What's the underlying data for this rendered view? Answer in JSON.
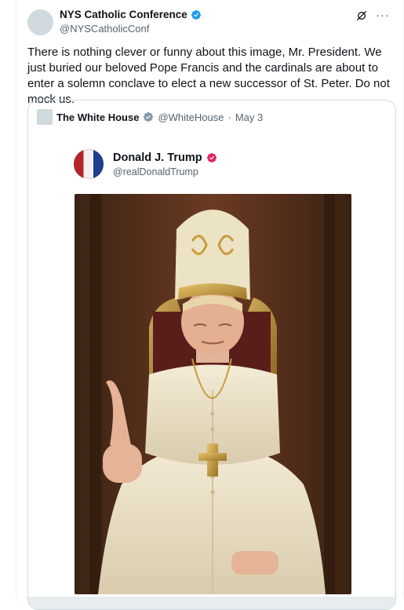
{
  "post": {
    "author": {
      "display_name": "NYS Catholic Conference",
      "handle": "@NYSCatholicConf"
    },
    "text": "There is nothing clever or funny about this image, Mr. President. We just buried our beloved Pope Francis and the cardinals are about to enter a solemn conclave to elect a new successor of St. Peter. Do not mock us.",
    "icons": [
      "verified-badge-icon",
      "grok-icon",
      "more-icon"
    ]
  },
  "quote": {
    "author": {
      "display_name": "The White House",
      "handle": "@WhiteHouse",
      "date_sep": "·",
      "date": "May 3"
    },
    "image_header": {
      "display_name": "Donald J. Trump",
      "handle": "@realDonaldTrump"
    }
  },
  "colors": {
    "verified_blue": "#1d9bf0",
    "white_house_badge": "#829aab",
    "trump_badge": "#e0245e",
    "text_primary": "#0f1419",
    "text_secondary": "#536471"
  }
}
